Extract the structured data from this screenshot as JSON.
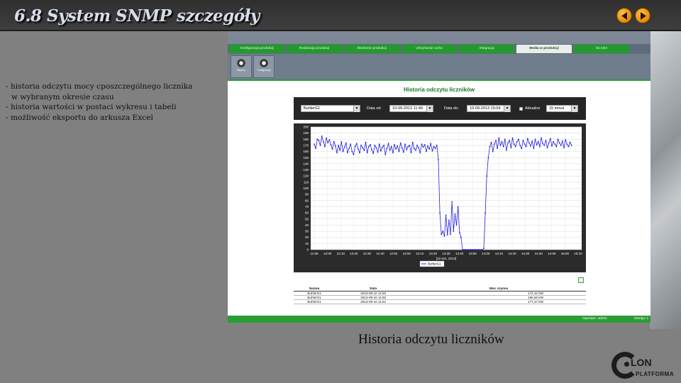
{
  "slide": {
    "title": "6.8 System SNMP szczegóły",
    "bullets": [
      "- historia odczytu mocy cposzczególnego licznika",
      "w wybranym okresie czasu",
      "- historia wartości w postaci wykresu i tabeli",
      "- możliwość eksportu do arkusza Excel"
    ],
    "caption": "Historia odczytu liczników",
    "logo_lon": "LON",
    "logo_platform": "PLATFORMA"
  },
  "app": {
    "menu_tabs": [
      "Konfiguracja produkcji",
      "Realizacja produkcji",
      "Śledzenie produkcji",
      "Utrzymanie ruchu",
      "Integracja",
      "Media w produkcji",
      "SCADA"
    ],
    "active_tab": 5,
    "sub_buttons": [
      "Raporty",
      "Konfiguracja"
    ],
    "chart_title": "Historia odczytu liczników",
    "filters": {
      "meter": "BuhlerG1",
      "date_from_label": "Data od:",
      "date_from": "10-09-2013 11:49",
      "date_to_label": "Data do:",
      "date_to": "10-09-2013 15:04",
      "current_label": "Aktualne",
      "interval": "15 minut"
    },
    "table": {
      "headers": [
        "Nazwa",
        "Data",
        "Moc czynna"
      ],
      "rows": [
        [
          "BuhlerG1",
          "2013-09-10 11:50",
          "172,42 kW"
        ],
        [
          "BuhlerG1",
          "2013-09-10 11:50",
          "155,50 kW"
        ],
        [
          "BuhlerG1",
          "2013-09-10 11:51",
          "177,37 kW"
        ]
      ]
    },
    "status": {
      "operator": "Operator: admin",
      "version": "Wersja: 1"
    }
  },
  "colors": {
    "accent_green": "#2a9d34",
    "series_blue": "#2222dd",
    "nav_orange": "#f0a020"
  },
  "chart_data": {
    "type": "line",
    "title": "",
    "xlabel": "[10 wrz, 2013]",
    "ylabel": "",
    "ylim": [
      0,
      200
    ],
    "yticks": [
      0,
      10,
      20,
      30,
      40,
      50,
      60,
      70,
      80,
      90,
      100,
      110,
      120,
      130,
      140,
      150,
      160,
      170,
      180,
      190,
      200
    ],
    "xticks": [
      "11:50",
      "12:00",
      "12:10",
      "12:20",
      "12:30",
      "12:40",
      "12:50",
      "13:00",
      "13:10",
      "13:20",
      "13:30",
      "13:40",
      "13:50",
      "14:00",
      "14:10",
      "14:20",
      "14:30",
      "14:40",
      "14:50",
      "15:00",
      "15:10"
    ],
    "legend": "bottom-center",
    "series": [
      {
        "name": "BuhlerG1",
        "x_start": "11:50",
        "x_end": "15:05",
        "values": [
          172,
          165,
          180,
          178,
          170,
          185,
          176,
          168,
          182,
          174,
          179,
          171,
          164,
          176,
          169,
          158,
          170,
          162,
          176,
          160,
          167,
          174,
          158,
          165,
          172,
          160,
          155,
          168,
          173,
          164,
          158,
          170,
          166,
          162,
          175,
          158,
          168,
          171,
          163,
          157,
          170,
          166,
          159,
          172,
          161,
          167,
          170,
          155,
          165,
          173,
          162,
          168,
          158,
          171,
          164,
          169,
          160,
          174,
          166,
          159,
          172,
          163,
          168,
          170,
          158,
          175,
          165,
          162,
          170,
          166,
          158,
          172,
          167,
          171,
          160,
          169,
          164,
          173,
          161,
          168,
          165,
          170,
          147,
          60,
          25,
          30,
          22,
          56,
          24,
          48,
          25,
          78,
          30,
          58,
          40,
          70,
          28,
          20,
          0,
          0,
          0,
          0,
          0,
          0,
          0,
          0,
          0,
          0,
          0,
          0,
          0,
          0,
          2,
          60,
          120,
          150,
          168,
          175,
          160,
          172,
          178,
          165,
          182,
          170,
          176,
          168,
          180,
          162,
          174,
          178,
          166,
          182,
          172,
          168,
          176,
          180,
          170,
          165,
          178,
          172,
          168,
          181,
          174,
          169,
          177,
          165,
          180,
          171,
          176,
          168,
          182,
          173,
          170,
          178,
          166,
          174,
          181,
          169,
          176,
          172,
          168,
          180,
          174,
          170,
          177,
          166,
          179,
          172,
          168,
          175,
          170
        ]
      }
    ]
  }
}
